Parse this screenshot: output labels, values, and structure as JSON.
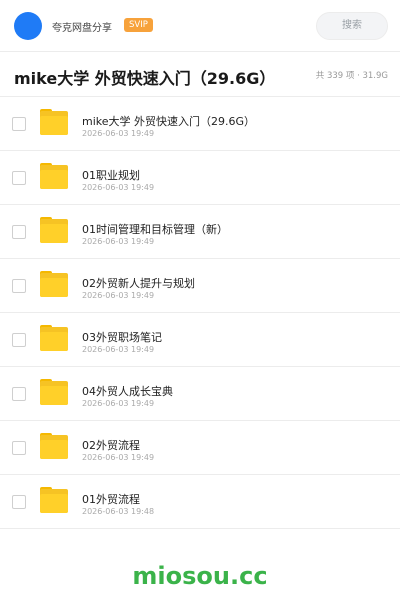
{
  "topbar": {
    "share_name": "夸克网盘分享",
    "badge": "SVIP",
    "search_placeholder": "搜索",
    "avatar_color": "#1f7bf6",
    "badge_color": "#f7a23b"
  },
  "folder": {
    "title": "mike大学 外贸快速入门（29.6G）",
    "summary": "共 339 项 · 31.9G"
  },
  "items": [
    {
      "name": "mike大学  外贸快速入门（29.6G）",
      "date": "2026-06-03 19:49",
      "icon": "folder-icon"
    },
    {
      "name": "01职业规划",
      "date": "2026-06-03 19:49",
      "icon": "folder-icon"
    },
    {
      "name": "01时间管理和目标管理（新）",
      "date": "2026-06-03 19:49",
      "icon": "folder-icon"
    },
    {
      "name": "02外贸新人提升与规划",
      "date": "2026-06-03 19:49",
      "icon": "folder-icon"
    },
    {
      "name": "03外贸职场笔记",
      "date": "2026-06-03 19:49",
      "icon": "folder-icon"
    },
    {
      "name": "04外贸人成长宝典",
      "date": "2026-06-03 19:49",
      "icon": "folder-icon"
    },
    {
      "name": "02外贸流程",
      "date": "2026-06-03 19:49",
      "icon": "folder-icon"
    },
    {
      "name": "01外贸流程",
      "date": "2026-06-03 19:48",
      "icon": "folder-icon"
    }
  ],
  "watermark": "miosou.cc",
  "colors": {
    "folder": "#ffd029",
    "watermark": "#3bb34a"
  }
}
